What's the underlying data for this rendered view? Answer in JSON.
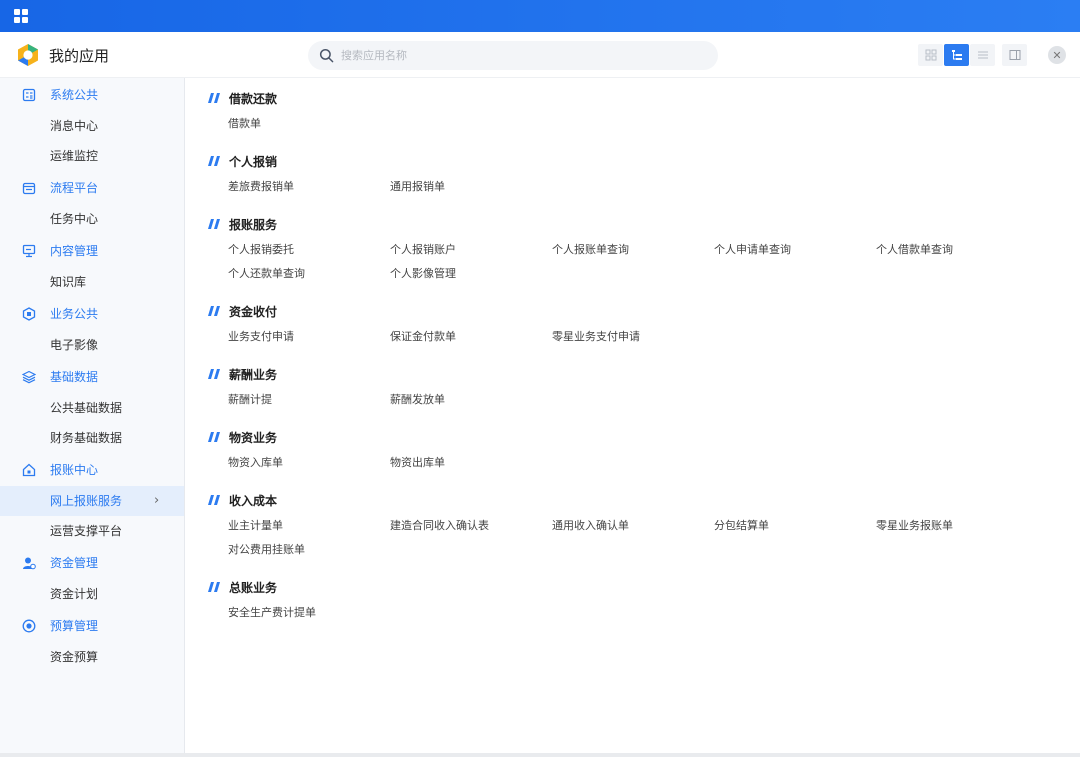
{
  "header": {
    "title": "我的应用",
    "search_placeholder": "搜索应用名称"
  },
  "sidebar": {
    "groups": [
      {
        "label": "系统公共",
        "icon": "calculator-icon",
        "items": [
          {
            "label": "消息中心"
          },
          {
            "label": "运维监控"
          }
        ]
      },
      {
        "label": "流程平台",
        "icon": "calendar-icon",
        "items": [
          {
            "label": "任务中心"
          }
        ]
      },
      {
        "label": "内容管理",
        "icon": "monitor-icon",
        "items": [
          {
            "label": "知识库"
          }
        ]
      },
      {
        "label": "业务公共",
        "icon": "hexagon-icon",
        "items": [
          {
            "label": "电子影像"
          }
        ]
      },
      {
        "label": "基础数据",
        "icon": "layers-icon",
        "items": [
          {
            "label": "公共基础数据"
          },
          {
            "label": "财务基础数据"
          }
        ]
      },
      {
        "label": "报账中心",
        "icon": "house-icon",
        "items": [
          {
            "label": "网上报账服务",
            "active": true
          },
          {
            "label": "运营支撑平台"
          }
        ]
      },
      {
        "label": "资金管理",
        "icon": "user-coin-icon",
        "items": [
          {
            "label": "资金计划"
          }
        ]
      },
      {
        "label": "预算管理",
        "icon": "target-icon",
        "items": [
          {
            "label": "资金预算"
          }
        ]
      }
    ]
  },
  "sections": [
    {
      "title": "借款还款",
      "items": [
        "借款单"
      ]
    },
    {
      "title": "个人报销",
      "items": [
        "差旅费报销单",
        "通用报销单"
      ]
    },
    {
      "title": "报账服务",
      "items": [
        "个人报销委托",
        "个人报销账户",
        "个人报账单查询",
        "个人申请单查询",
        "个人借款单查询",
        "个人还款单查询",
        "个人影像管理"
      ]
    },
    {
      "title": "资金收付",
      "items": [
        "业务支付申请",
        "保证金付款单",
        "零星业务支付申请"
      ]
    },
    {
      "title": "薪酬业务",
      "items": [
        "薪酬计提",
        "薪酬发放单"
      ]
    },
    {
      "title": "物资业务",
      "items": [
        "物资入库单",
        "物资出库单"
      ]
    },
    {
      "title": "收入成本",
      "items": [
        "业主计量单",
        "建造合同收入确认表",
        "通用收入确认单",
        "分包结算单",
        "零星业务报账单",
        "对公费用挂账单"
      ]
    },
    {
      "title": "总账业务",
      "items": [
        "安全生产费计提单"
      ]
    }
  ],
  "colors": {
    "accent": "#2c7bf0",
    "topbar": "#1766e6"
  }
}
